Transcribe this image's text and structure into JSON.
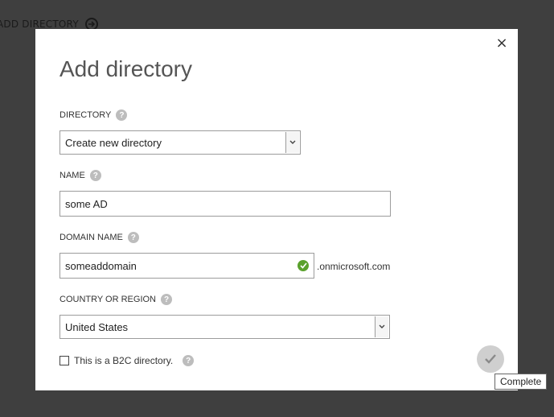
{
  "background": {
    "header_label": "ADD DIRECTORY",
    "header_icon": "arrow-right-circle-icon"
  },
  "dialog": {
    "title": "Add directory",
    "close_icon": "close-icon",
    "directory": {
      "label": "DIRECTORY",
      "selected": "Create new directory"
    },
    "name": {
      "label": "NAME",
      "value": "some AD"
    },
    "domain": {
      "label": "DOMAIN NAME",
      "value": "someaddomain",
      "suffix": ".onmicrosoft.com",
      "status_icon": "check-circle-icon"
    },
    "country": {
      "label": "COUNTRY OR REGION",
      "selected": "United States"
    },
    "b2c": {
      "label": "This is a B2C directory.",
      "checked": false
    },
    "help_glyph": "?",
    "complete": {
      "icon": "checkmark-icon",
      "tooltip": "Complete"
    }
  },
  "colors": {
    "backdrop": "#3f3f3f",
    "dialog": "#ffffff",
    "valid": "#5aa12c",
    "complete_button": "#cfcfcf"
  }
}
